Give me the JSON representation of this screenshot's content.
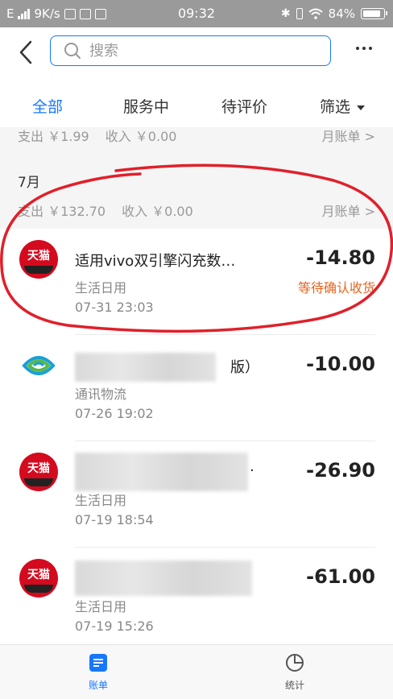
{
  "status_bar": {
    "left": "E",
    "speed": "9K/s",
    "time": "09:32",
    "battery": "84%"
  },
  "header": {
    "search_placeholder": "搜索"
  },
  "tabs": [
    {
      "label": "全部",
      "active": true
    },
    {
      "label": "服务中",
      "active": false
    },
    {
      "label": "待评价",
      "active": false
    },
    {
      "label": "筛选",
      "active": false
    }
  ],
  "prev_month": {
    "expense": "支出 ￥1.99",
    "income": "收入 ￥0.00",
    "monthly_bill": "月账单 >"
  },
  "july": {
    "label": "7月",
    "expense": "支出 ￥132.70",
    "income": "收入 ￥0.00",
    "monthly_bill": "月账单 >"
  },
  "transactions": [
    {
      "title": "适用vivo双引擎闪充数…",
      "category": "生活日用",
      "datetime": "07-31  23:03",
      "amount": "-14.80",
      "status": "等待确认收货",
      "logo": "tmall-logo"
    },
    {
      "title": "版）",
      "category": "通讯物流",
      "datetime": "07-26  19:02",
      "amount": "-10.00",
      "status": "",
      "logo": "china-mobile-logo"
    },
    {
      "title": "·",
      "category": "生活日用",
      "datetime": "07-19  18:54",
      "amount": "-26.90",
      "status": "",
      "logo": "tmall-logo"
    },
    {
      "title": "",
      "category": "生活日用",
      "datetime": "07-19  15:26",
      "amount": "-61.00",
      "status": "",
      "logo": "tmall-logo"
    }
  ],
  "tmall_logo_text": "天猫",
  "bottom_nav": [
    {
      "label": "账单",
      "icon": "bill-icon",
      "active": true
    },
    {
      "label": "统计",
      "icon": "pie-chart-icon",
      "active": false
    }
  ],
  "colors": {
    "accent": "#1677ff",
    "status_orange": "#e6641f",
    "tmall_red": "#d40a1e",
    "annotation_red": "#e0202a"
  }
}
